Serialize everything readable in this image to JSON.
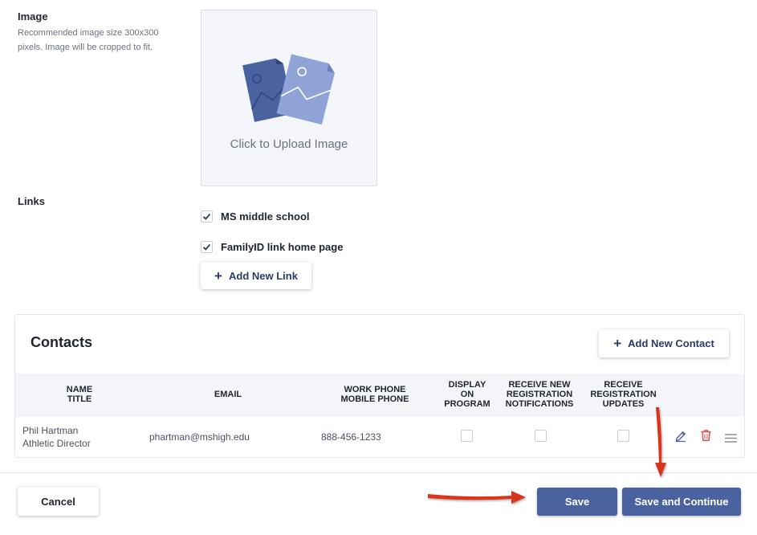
{
  "image_field": {
    "title": "Image",
    "help": "Recommended image size 300x300 pixels. Image will be cropped to fit.",
    "upload_text": "Click to Upload Image"
  },
  "links": {
    "title": "Links",
    "items": [
      {
        "label": "MS middle school",
        "checked": true
      },
      {
        "label": "FamilyID link home page",
        "checked": true
      }
    ],
    "add_label": "Add New Link"
  },
  "contacts": {
    "title": "Contacts",
    "add_label": "Add New Contact",
    "columns": {
      "name_1": "NAME",
      "name_2": "TITLE",
      "email": "EMAIL",
      "phone_1": "WORK PHONE",
      "phone_2": "MOBILE PHONE",
      "display_1": "DISPLAY",
      "display_2": "ON",
      "display_3": "PROGRAM",
      "notif_1": "RECEIVE NEW",
      "notif_2": "REGISTRATION",
      "notif_3": "NOTIFICATIONS",
      "updates_1": "RECEIVE",
      "updates_2": "REGISTRATION",
      "updates_3": "UPDATES"
    },
    "rows": [
      {
        "name": "Phil Hartman",
        "title": "Athletic Director",
        "email": "phartman@mshigh.edu",
        "phone": "888-456-1233"
      }
    ]
  },
  "footer": {
    "cancel_label": "Cancel",
    "save_label": "Save",
    "save_continue_label": "Save and Continue"
  },
  "colors": {
    "primary": "#4a63a0",
    "accent_text": "#2b3a67",
    "delete": "#d9534f",
    "annotation_arrow": "#d9361f"
  }
}
